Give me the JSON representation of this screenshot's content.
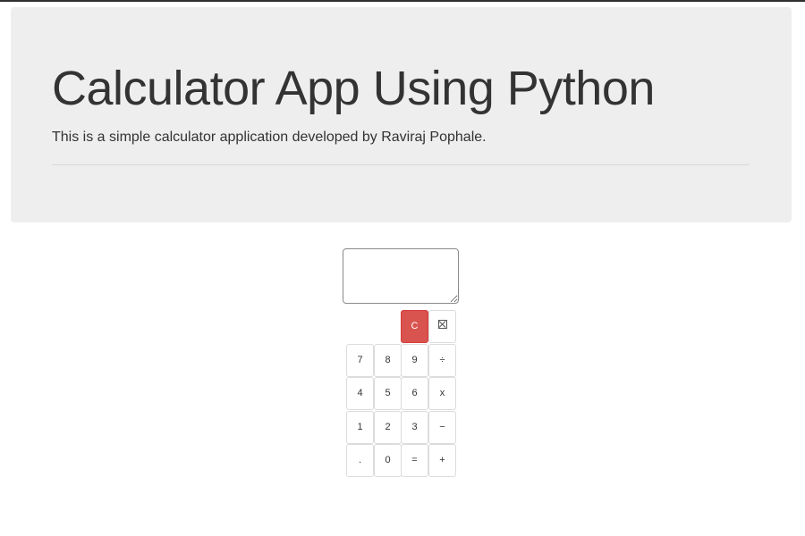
{
  "jumbotron": {
    "title": "Calculator App Using Python",
    "subtitle": "This is a simple calculator application developed by Raviraj Pophale."
  },
  "display": {
    "value": ""
  },
  "keys": {
    "clear": "C",
    "backspace_icon": "backspace-box-icon",
    "k7": "7",
    "k8": "8",
    "k9": "9",
    "divide": "÷",
    "k4": "4",
    "k5": "5",
    "k6": "6",
    "multiply": "x",
    "k1": "1",
    "k2": "2",
    "k3": "3",
    "minus": "−",
    "dot": ".",
    "k0": "0",
    "equals": "=",
    "plus": "+"
  },
  "colors": {
    "header_bg": "#eeeeee",
    "clear_button": "#d9534f"
  }
}
